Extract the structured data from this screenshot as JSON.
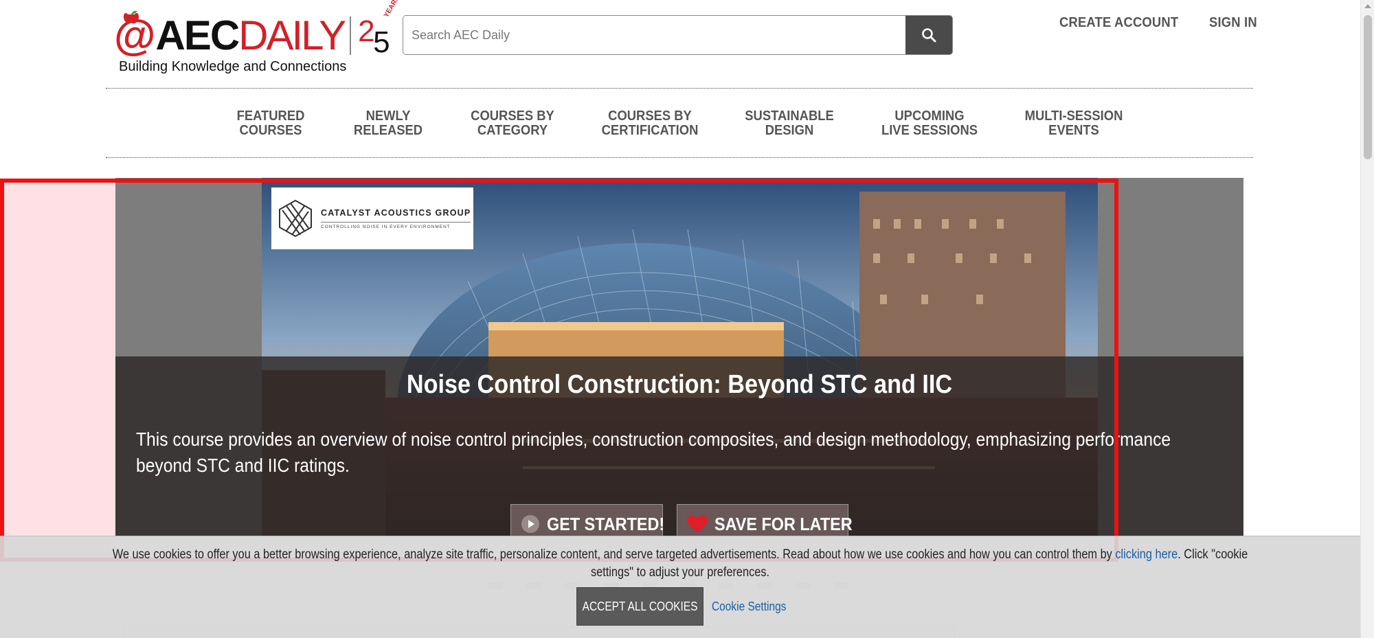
{
  "header": {
    "logo": {
      "at": "@",
      "aec": "AEC",
      "daily": "DAILY",
      "years_two": "2",
      "years_five": "5",
      "years_word": "YEARS"
    },
    "tagline": "Building Knowledge and Connections",
    "search": {
      "placeholder": "Search AEC Daily",
      "value": ""
    },
    "account": {
      "create": "CREATE ACCOUNT",
      "signin": "SIGN IN"
    }
  },
  "nav": {
    "items": [
      {
        "line1": "FEATURED",
        "line2": "COURSES"
      },
      {
        "line1": "NEWLY",
        "line2": "RELEASED"
      },
      {
        "line1": "COURSES BY",
        "line2": "CATEGORY"
      },
      {
        "line1": "COURSES BY",
        "line2": "CERTIFICATION"
      },
      {
        "line1": "SUSTAINABLE",
        "line2": "DESIGN"
      },
      {
        "line1": "UPCOMING",
        "line2": "LIVE SESSIONS"
      },
      {
        "line1": "MULTI-SESSION",
        "line2": "EVENTS"
      }
    ]
  },
  "hero": {
    "sponsor": {
      "name": "CATALYST ACOUSTICS GROUP",
      "tagline": "CONTROLLING NOISE IN EVERY ENVIRONMENT"
    },
    "title": "Noise Control Construction: Beyond STC and IIC",
    "description": "This course provides an overview of noise control principles, construction composites, and design methodology, emphasizing performance beyond STC and IIC ratings.",
    "buttons": {
      "start": "GET STARTED!",
      "save": "SAVE FOR LATER"
    }
  },
  "cookie": {
    "icon_glyph": "",
    "text_before": "We use cookies to offer you a better browsing experience, analyze site traffic, personalize content, and serve targeted advertisements. Read about how we use cookies and how you can control them by ",
    "link_text": "clicking here",
    "text_after": ". Click \"cookie settings\" to adjust your preferences.",
    "accept": "ACCEPT ALL COOKIES",
    "settings": "Cookie Settings"
  },
  "colors": {
    "brand_red": "#d32027",
    "highlight": "#ee1111",
    "link": "#1b5fa8"
  }
}
